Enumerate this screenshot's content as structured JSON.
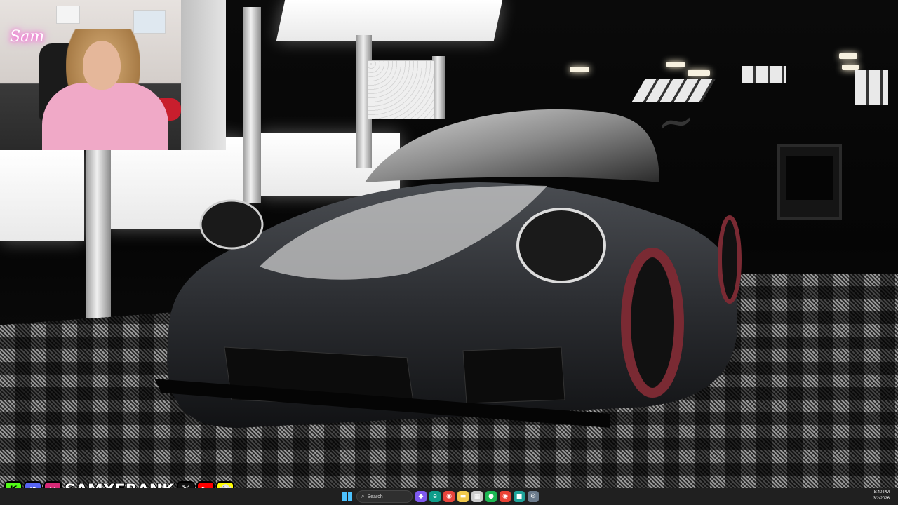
{
  "overlay": {
    "neon_sign": "Sam",
    "handle": "SAMXFRANK",
    "social_icons": [
      {
        "name": "kick",
        "glyph": "K",
        "color": "#53fc18"
      },
      {
        "name": "discord",
        "glyph": "◕",
        "color": "#5865f2"
      },
      {
        "name": "instagram",
        "glyph": "◎",
        "color": "#d62976"
      },
      {
        "name": "x",
        "glyph": "𝕏",
        "color": "#111111"
      },
      {
        "name": "youtube",
        "glyph": "▶",
        "color": "#ff0000"
      },
      {
        "name": "snapchat",
        "glyph": "👻",
        "color": "#fffc00"
      }
    ]
  },
  "taskbar": {
    "search_placeholder": "Search",
    "pinned_icons": [
      {
        "name": "copilot",
        "glyph": "◆",
        "color": "#7f5af0"
      },
      {
        "name": "edge",
        "glyph": "e",
        "color": "#0f9d8a"
      },
      {
        "name": "chrome",
        "glyph": "◉",
        "color": "#e8453c"
      },
      {
        "name": "file-explorer",
        "glyph": "▬",
        "color": "#f2c94c"
      },
      {
        "name": "calendar",
        "glyph": "▦",
        "color": "#cccccc"
      },
      {
        "name": "spotify",
        "glyph": "●",
        "color": "#1db954"
      },
      {
        "name": "chrome-profile",
        "glyph": "◉",
        "color": "#ea4335"
      },
      {
        "name": "app-teal",
        "glyph": "■",
        "color": "#1fa39a"
      },
      {
        "name": "settings",
        "glyph": "⚙",
        "color": "#6b7b8c"
      }
    ],
    "clock_time": "8:40 PM",
    "clock_date": "3/2/2026"
  }
}
